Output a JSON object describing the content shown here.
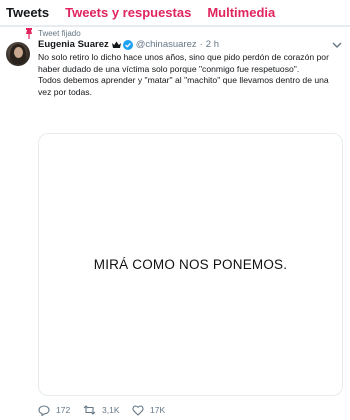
{
  "tabs": [
    {
      "label": "Tweets",
      "active": true
    },
    {
      "label": "Tweets y respuestas",
      "active": false
    },
    {
      "label": "Multimedia",
      "active": false
    }
  ],
  "tweet": {
    "pinned_label": "Tweet fijado",
    "author": {
      "name": "Eugenia Suarez",
      "handle": "@chinasuarez",
      "dot": "·",
      "time": "2 h"
    },
    "text_paragraphs": [
      "No solo retiro lo dicho hace unos años, sino que pido perdón de corazón por haber dudado de una víctima solo porque \"conmigo fue respetuoso\".",
      "Todos debemos aprender y \"matar\" al \"machito\" que llevamos dentro de una vez por todas."
    ],
    "media_text": "MIRÁ COMO NOS PONEMOS.",
    "stats": {
      "replies": "172",
      "retweets": "3,1K",
      "likes": "17K"
    }
  },
  "colors": {
    "accent_tab": "#e0245e",
    "secondary_text": "#657786",
    "verified": "#1da1f2",
    "pin": "#e0245e"
  },
  "icons": {
    "pin": "pin-icon",
    "crown": "crown-icon",
    "verified": "verified-badge-icon",
    "chevron": "chevron-down-icon",
    "reply": "reply-icon",
    "retweet": "retweet-icon",
    "like": "heart-icon"
  }
}
